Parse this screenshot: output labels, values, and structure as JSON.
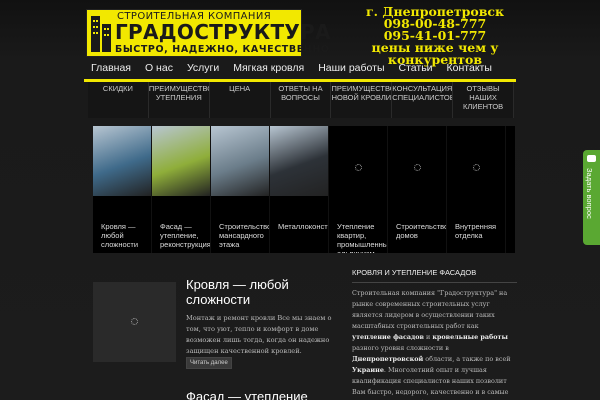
{
  "header": {
    "logo_line1": "СТРОИТЕЛЬНАЯ КОМПАНИЯ",
    "logo_line2": "ГРАДОСТРУКТУРА",
    "logo_line3": "БЫСТРО, НАДЕЖНО, КАЧЕСТВЕННО",
    "contacts": [
      "г. Днепропетровск",
      "098-00-48-777",
      "095-41-01-777",
      "цены ниже чем у",
      "конкурентов"
    ]
  },
  "topnav": [
    "Главная",
    "О нас",
    "Услуги",
    "Мягкая кровля",
    "Наши работы",
    "Статьи",
    "Контакты"
  ],
  "subnav": [
    "СКИДКИ",
    "ПРЕИМУЩЕСТВО УТЕПЛЕНИЯ",
    "ЦЕНА",
    "ОТВЕТЫ НА ВОПРОСЫ",
    "ПРЕИМУЩЕСТВО НОВОЙ КРОВЛИ",
    "КОНСУЛЬТАЦИЯ СПЕЦИАЛИСТОВ",
    "ОТЗЫВЫ НАШИХ КЛИЕНТОВ"
  ],
  "gallery": [
    {
      "caption": "Кровля — любой сложности",
      "color": "#3f6a8a"
    },
    {
      "caption": "Фасад — утепление, реконструкция",
      "color": "#8fae3a"
    },
    {
      "caption": "Строительство мансардного этажа",
      "color": "#6b7d8a"
    },
    {
      "caption": "Металлоконструкции",
      "color": "#2d3238"
    },
    {
      "caption": "Утепление квартир, промышленный альпинизм",
      "color": "#000000"
    },
    {
      "caption": "Строительство домов",
      "color": "#000000"
    },
    {
      "caption": "Внутренняя отделка",
      "color": "#000000"
    }
  ],
  "post": {
    "title": "Кровля — любой сложности",
    "text": "Монтаж и ремонт кровли Все мы знаем о том, что уют, тепло и комфорт в доме возможен лишь тогда, когда он надежно защищен качественной кровлей.",
    "more": "Читать далее",
    "next_title": "Фасад — утепление"
  },
  "sidebar": {
    "title": "КРОВЛЯ И УТЕПЛЕНИЕ ФАСАДОВ",
    "p1": "Строительная компания \"Градоструктура\" на рынке современных строительных услуг является лидером в осуществлении таких масштабных строительных работ как",
    "b1": "утепление фасадов",
    "p2": " и ",
    "b2": "кровельные работы",
    "p3": " разного уровня сложности в ",
    "b3": "Днепропетровской",
    "p4": " области, а также по всей ",
    "b4": "Украине",
    "p5": ". Многолетний опыт и лучшая квалификация специалистов наших позволит Вам быстро, недорого, качественно и в самые краткие сроки преобразить и воплотить в жизнь всё что Вы"
  },
  "feedback_label": "Задать вопрос"
}
